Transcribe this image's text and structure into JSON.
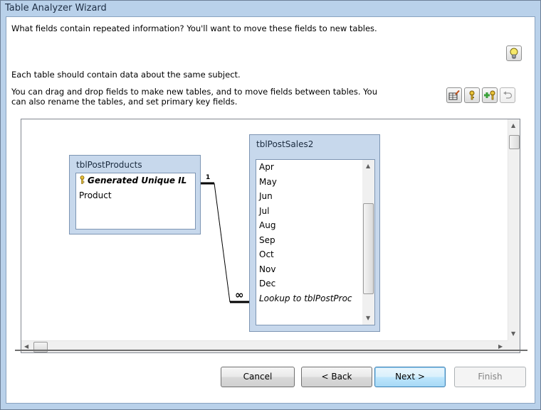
{
  "window": {
    "title": "Table Analyzer Wizard"
  },
  "instructions": {
    "line1": "What fields contain repeated information? You'll want to move these fields to new tables.",
    "line2": "Each table should contain data about the same subject.",
    "line3a": "You can drag and drop fields to make new tables, and to move fields between tables. You",
    "line3b": "can also rename the tables, and set primary key fields."
  },
  "tables": {
    "products": {
      "name": "tblPostProducts",
      "fields": [
        "Generated Unique IL",
        "Product"
      ]
    },
    "sales": {
      "name": "tblPostSales2",
      "fields": [
        "Apr",
        "May",
        "Jun",
        "Jul",
        "Aug",
        "Sep",
        "Oct",
        "Nov",
        "Dec",
        "Lookup to tblPostProc"
      ]
    }
  },
  "relationship": {
    "one_label": "1",
    "many_label": "∞"
  },
  "buttons": {
    "cancel": "Cancel",
    "back": "< Back",
    "next": "Next >",
    "finish": "Finish"
  },
  "colors": {
    "accent": "#3c7fb1",
    "table_header": "#c7d8ec",
    "key_icon": "#d4a017"
  }
}
